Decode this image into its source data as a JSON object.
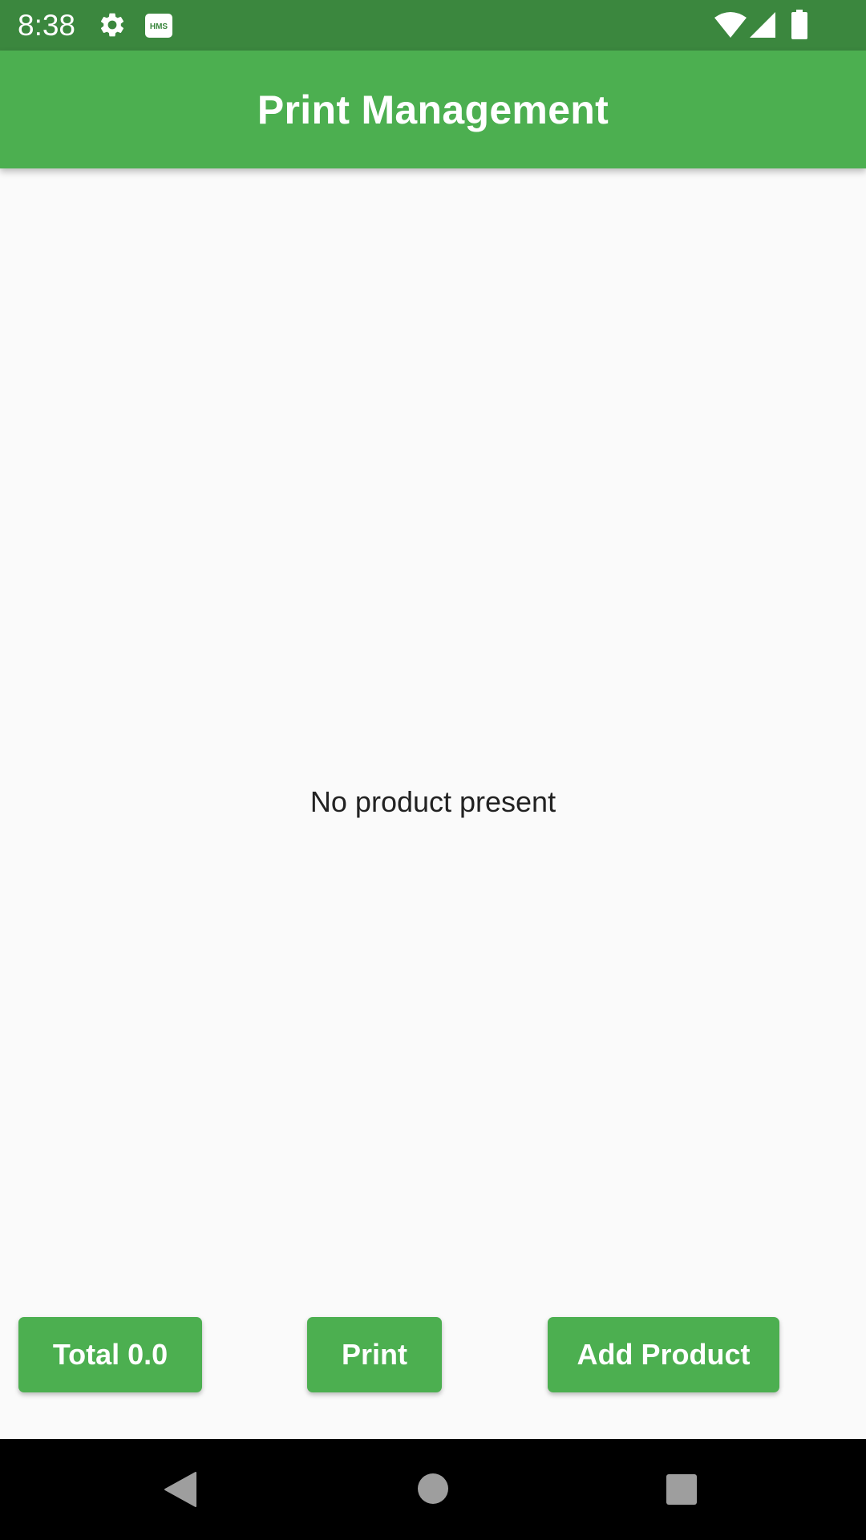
{
  "status_bar": {
    "time": "8:38",
    "icons": [
      "gear-icon",
      "hms-icon",
      "wifi-icon",
      "signal-icon",
      "battery-icon"
    ],
    "hms_label": "HMS",
    "background_color": "#3b873e"
  },
  "app_bar": {
    "title": "Print Management",
    "background_color": "#4caf50"
  },
  "main": {
    "empty_message": "No product present"
  },
  "actions": {
    "total_label": "Total 0.0",
    "print_label": "Print",
    "add_product_label": "Add Product",
    "button_color": "#4caf50"
  },
  "nav_bar": {
    "icons": [
      "back-icon",
      "home-icon",
      "recents-icon"
    ]
  }
}
